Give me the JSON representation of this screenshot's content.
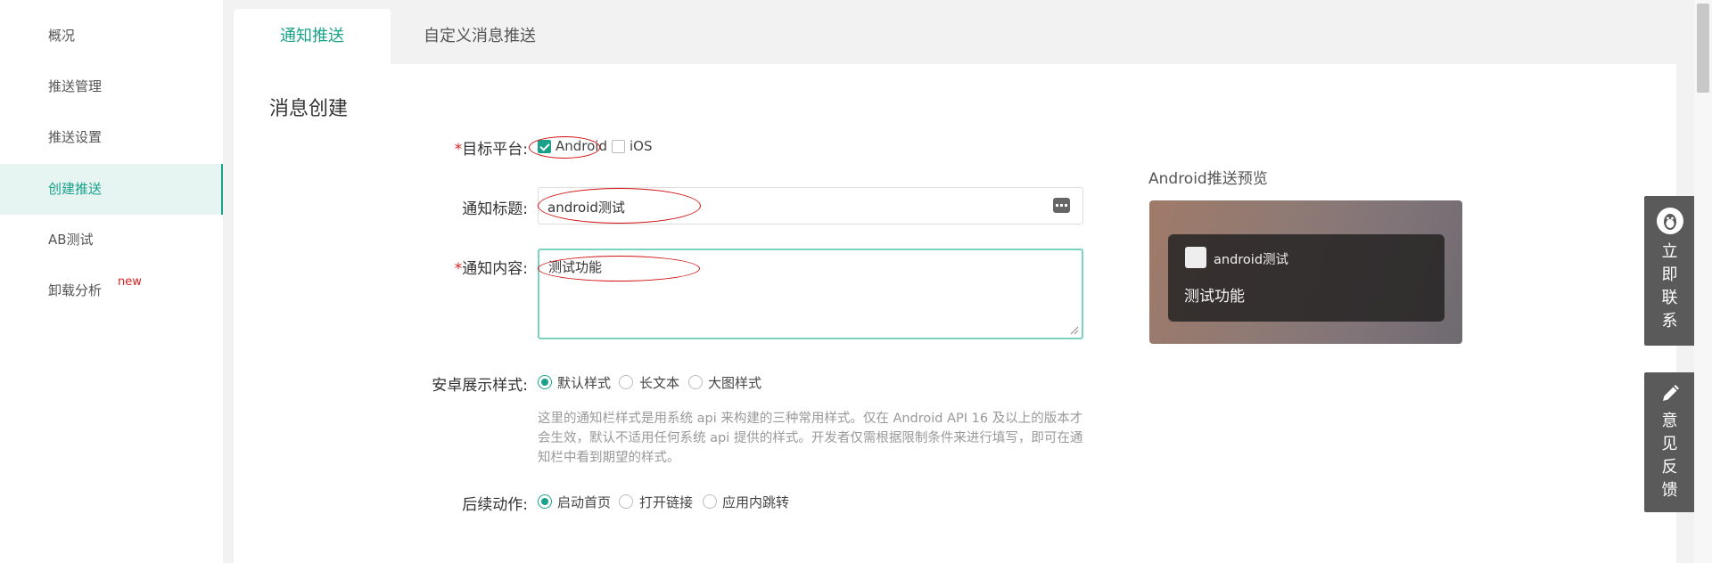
{
  "sidebar": {
    "items": [
      {
        "label": "概况"
      },
      {
        "label": "推送管理"
      },
      {
        "label": "推送设置"
      },
      {
        "label": "创建推送"
      },
      {
        "label": "AB测试"
      },
      {
        "label": "卸载分析",
        "badge": "new"
      }
    ],
    "active_index": 3
  },
  "tabs": [
    {
      "label": "通知推送",
      "active": true
    },
    {
      "label": "自定义消息推送",
      "active": false
    }
  ],
  "page_title": "消息创建",
  "form": {
    "platform": {
      "required": "*",
      "label": "目标平台:",
      "options": [
        {
          "label": "Android",
          "checked": true
        },
        {
          "label": "iOS",
          "checked": false
        }
      ]
    },
    "title": {
      "label": "通知标题:",
      "value": "android测试"
    },
    "content": {
      "required": "*",
      "label": "通知内容:",
      "value": "测试功能"
    },
    "style": {
      "label": "安卓展示样式:",
      "options": [
        {
          "label": "默认样式",
          "checked": true
        },
        {
          "label": "长文本",
          "checked": false
        },
        {
          "label": "大图样式",
          "checked": false
        }
      ],
      "hint": "这里的通知栏样式是用系统 api 来构建的三种常用样式。仅在 Android API 16 及以上的版本才会生效，默认不适用任何系统 api 提供的样式。开发者仅需根据限制条件来进行填写，即可在通知栏中看到期望的样式。"
    },
    "action": {
      "label": "后续动作:",
      "options": [
        {
          "label": "启动首页",
          "checked": true
        },
        {
          "label": "打开链接",
          "checked": false
        },
        {
          "label": "应用内跳转",
          "checked": false
        }
      ]
    }
  },
  "preview": {
    "title": "Android推送预览",
    "notif_title": "android测试",
    "notif_body": "测试功能"
  },
  "float_buttons": {
    "contact": {
      "chars": [
        "立",
        "即",
        "联",
        "系"
      ],
      "icon": "qq-penguin-icon"
    },
    "feedback": {
      "chars": [
        "意",
        "见",
        "反",
        "馈"
      ],
      "icon": "pencil-icon"
    }
  },
  "colors": {
    "accent": "#1aa18a",
    "required": "#e02020",
    "annotation": "#d01010"
  }
}
